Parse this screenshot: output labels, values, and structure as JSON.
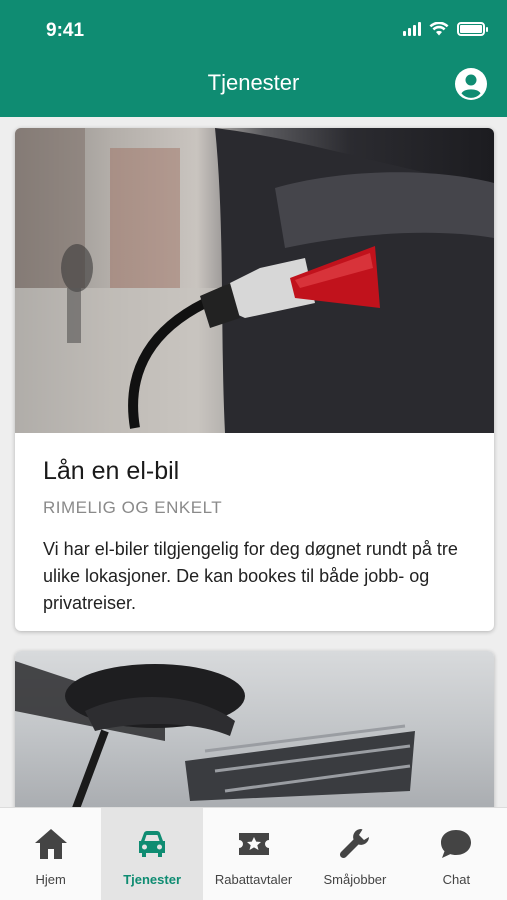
{
  "status_bar": {
    "time": "9:41"
  },
  "header": {
    "title": "Tjenester"
  },
  "cards": [
    {
      "title": "Lån en el-bil",
      "subtitle": "RIMELIG OG ENKELT",
      "description": "Vi har el-biler tilgjengelig for deg døgnet rundt på tre ulike lokasjoner. De kan bookes til både jobb- og privatreiser."
    }
  ],
  "tabs": [
    {
      "label": "Hjem",
      "icon": "home-icon",
      "active": false
    },
    {
      "label": "Tjenester",
      "icon": "car-icon",
      "active": true
    },
    {
      "label": "Rabattavtaler",
      "icon": "ticket-icon",
      "active": false
    },
    {
      "label": "Småjobber",
      "icon": "wrench-icon",
      "active": false
    },
    {
      "label": "Chat",
      "icon": "chat-icon",
      "active": false
    }
  ],
  "colors": {
    "brand": "#0f8c72",
    "active_tab_bg": "#e4e4e4"
  }
}
